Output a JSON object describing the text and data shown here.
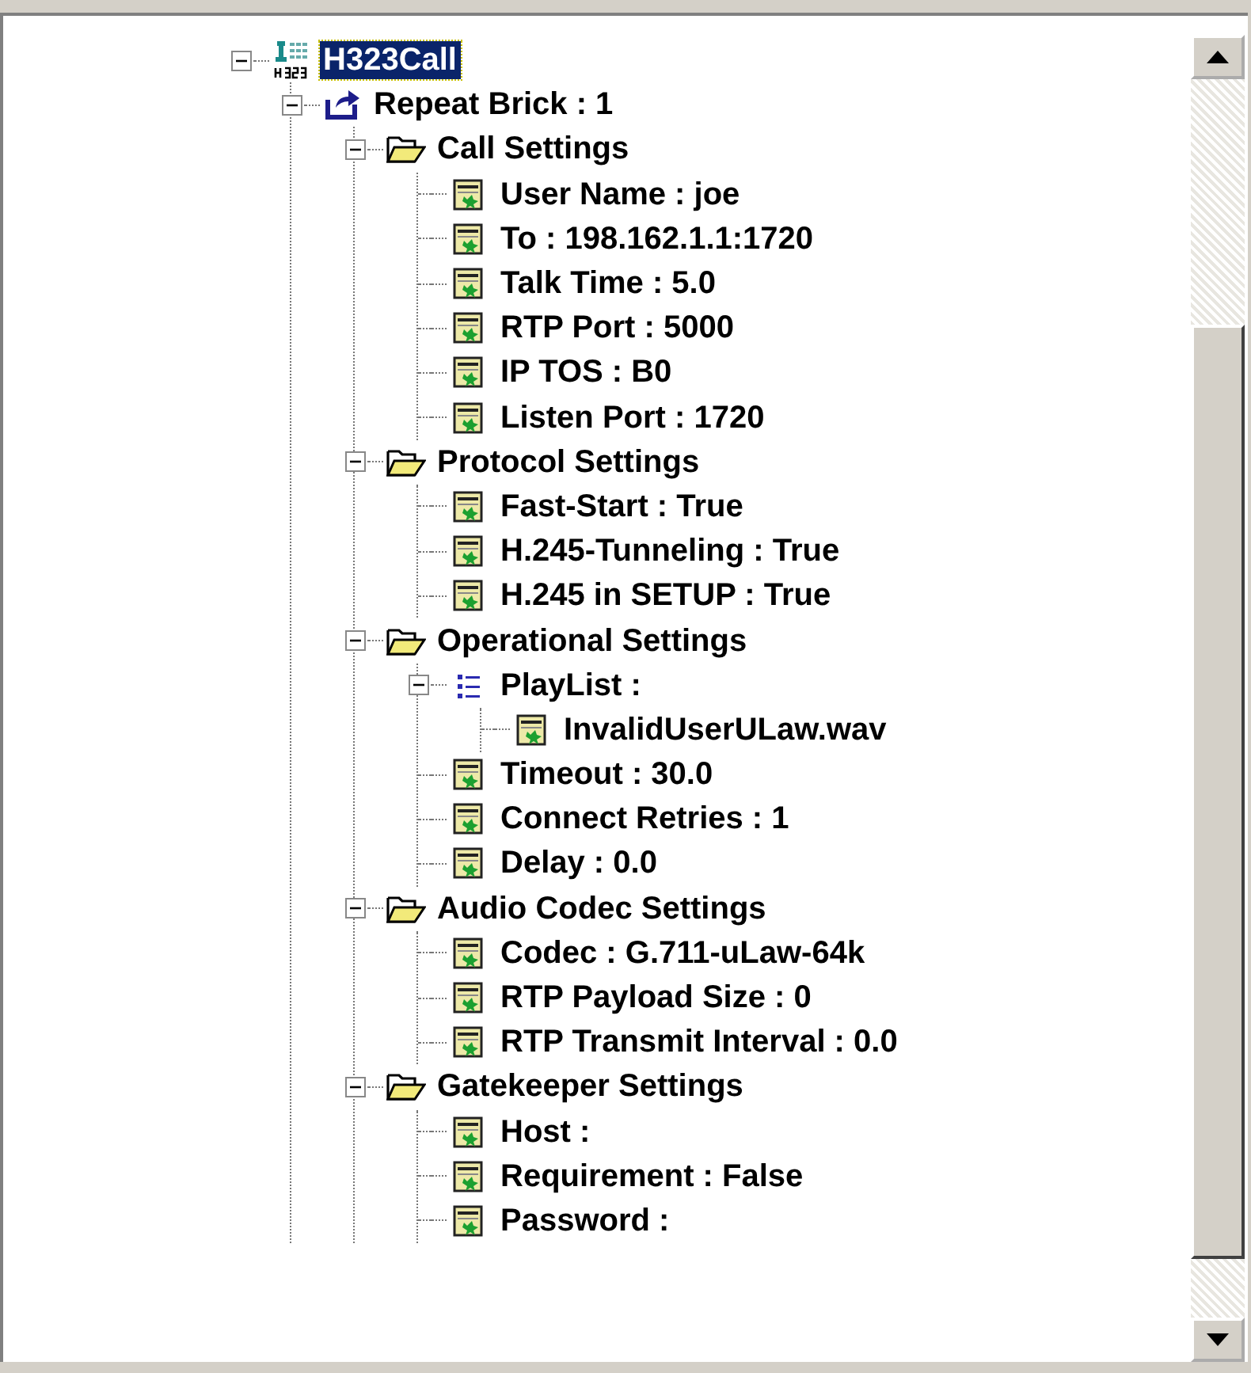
{
  "tree": [
    {
      "kind": "call",
      "label": "H323Call",
      "selected": true,
      "expanded": true,
      "children": [
        {
          "kind": "repeat",
          "label": "Repeat Brick : 1",
          "selected": false,
          "expanded": true,
          "children": [
            {
              "kind": "folder",
              "label": "Call Settings",
              "selected": false,
              "expanded": true,
              "children": [
                {
                  "kind": "param",
                  "label": "User Name : joe",
                  "selected": false
                },
                {
                  "kind": "param",
                  "label": "To : 198.162.1.1:1720",
                  "selected": false
                },
                {
                  "kind": "param",
                  "label": "Talk Time : 5.0",
                  "selected": false
                },
                {
                  "kind": "param",
                  "label": "RTP Port : 5000",
                  "selected": false
                },
                {
                  "kind": "param",
                  "label": "IP TOS : B0",
                  "selected": false
                },
                {
                  "kind": "param",
                  "label": "Listen Port : 1720",
                  "selected": false
                }
              ]
            },
            {
              "kind": "folder",
              "label": "Protocol Settings",
              "selected": false,
              "expanded": true,
              "children": [
                {
                  "kind": "param",
                  "label": "Fast-Start : True",
                  "selected": false
                },
                {
                  "kind": "param",
                  "label": "H.245-Tunneling : True",
                  "selected": false
                },
                {
                  "kind": "param",
                  "label": "H.245 in SETUP : True",
                  "selected": false
                }
              ]
            },
            {
              "kind": "folder",
              "label": "Operational Settings",
              "selected": false,
              "expanded": true,
              "children": [
                {
                  "kind": "list",
                  "label": "PlayList :",
                  "selected": false,
                  "expanded": true,
                  "children": [
                    {
                      "kind": "param",
                      "label": "InvalidUserULaw.wav",
                      "selected": false
                    }
                  ]
                },
                {
                  "kind": "param",
                  "label": "Timeout : 30.0",
                  "selected": false
                },
                {
                  "kind": "param",
                  "label": "Connect Retries : 1",
                  "selected": false
                },
                {
                  "kind": "param",
                  "label": "Delay : 0.0",
                  "selected": false
                }
              ]
            },
            {
              "kind": "folder",
              "label": "Audio Codec Settings",
              "selected": false,
              "expanded": true,
              "children": [
                {
                  "kind": "param",
                  "label": "Codec : G.711-uLaw-64k",
                  "selected": false
                },
                {
                  "kind": "param",
                  "label": "RTP Payload Size : 0",
                  "selected": false
                },
                {
                  "kind": "param",
                  "label": "RTP Transmit Interval : 0.0",
                  "selected": false
                }
              ]
            },
            {
              "kind": "folder",
              "label": "Gatekeeper Settings",
              "selected": false,
              "expanded": true,
              "children": [
                {
                  "kind": "param",
                  "label": "Host :",
                  "selected": false
                },
                {
                  "kind": "param",
                  "label": "Requirement : False",
                  "selected": false
                },
                {
                  "kind": "param",
                  "label": "Password :",
                  "selected": false
                }
              ]
            }
          ]
        }
      ]
    }
  ]
}
